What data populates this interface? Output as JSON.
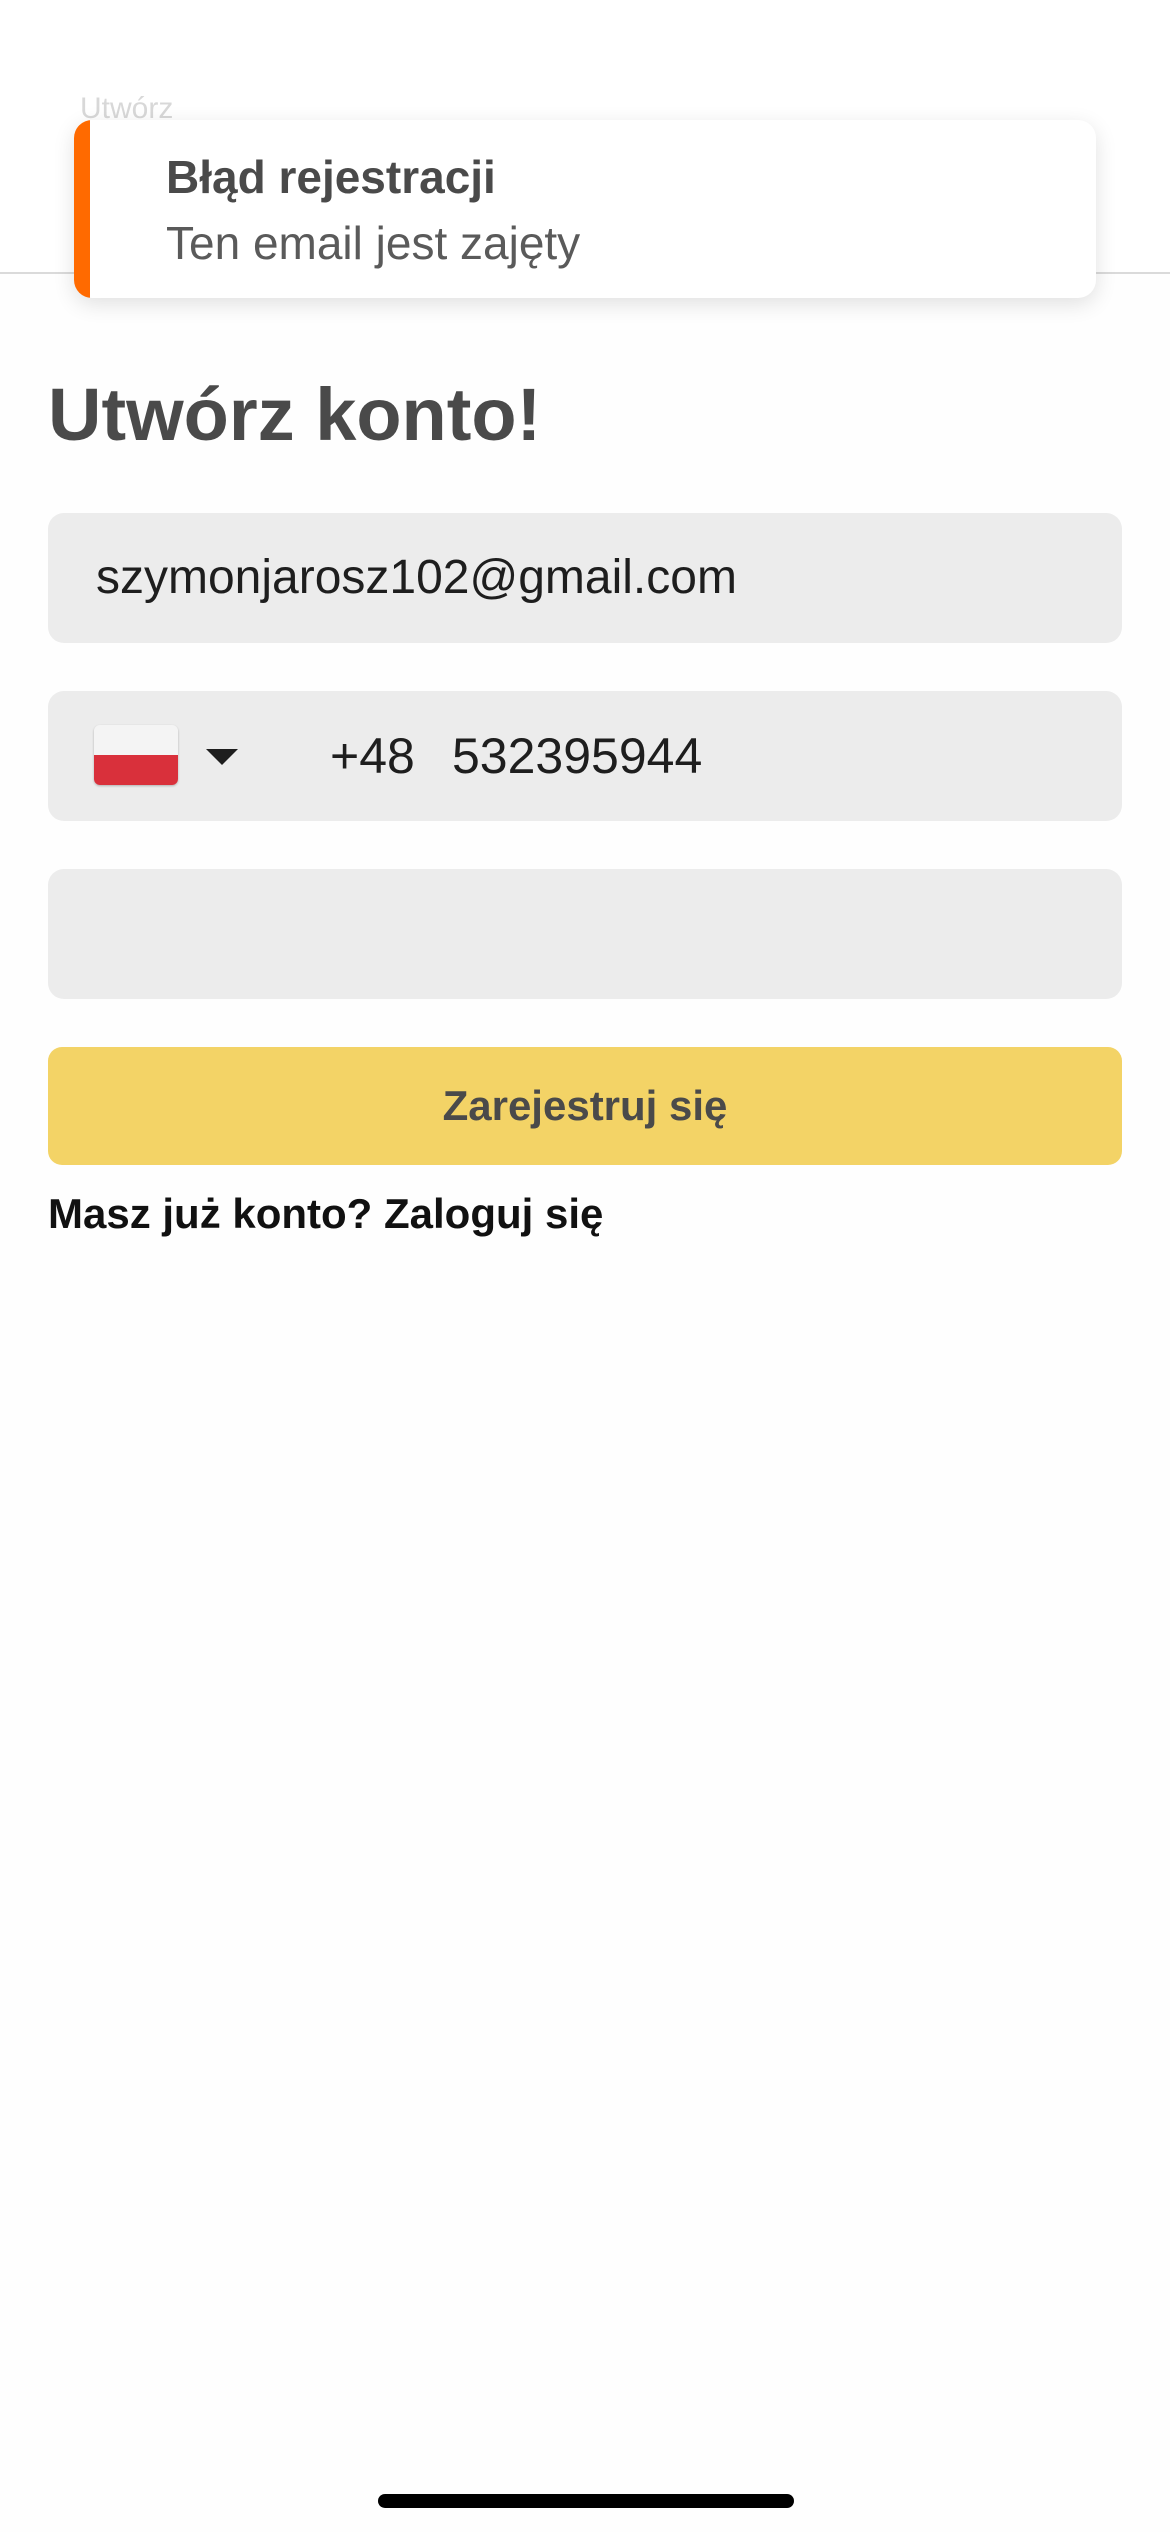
{
  "header": {
    "partial_text": "Utwórz"
  },
  "toast": {
    "title": "Błąd rejestracji",
    "message": "Ten email jest zajęty",
    "accent_color": "#ff6a00"
  },
  "page": {
    "title": "Utwórz konto!"
  },
  "form": {
    "email_value": "szymonjarosz102@gmail.com",
    "country_flag": "poland-flag-icon",
    "dial_code": "+48",
    "phone_value": "532395944",
    "password_value": "",
    "register_label": "Zarejestruj się",
    "login_prompt": "Masz już konto? Zaloguj się"
  },
  "colors": {
    "button_bg": "#f3d366",
    "field_bg": "#ececec",
    "text_dark": "#4a4a4a"
  }
}
